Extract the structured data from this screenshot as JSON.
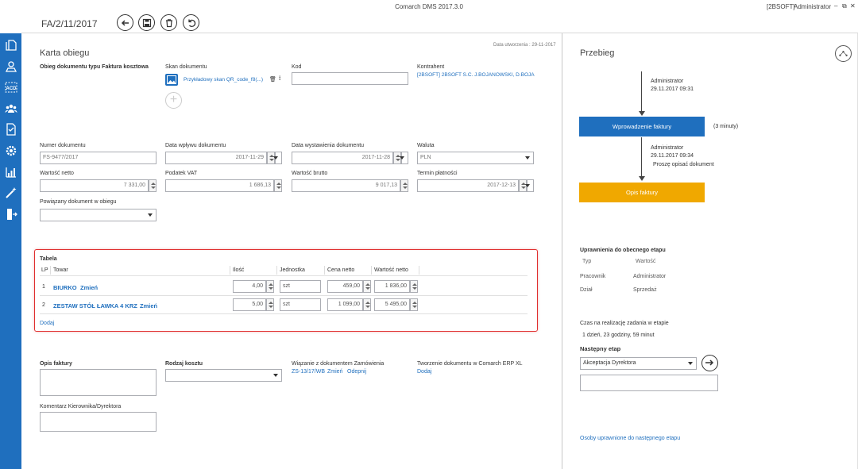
{
  "window": {
    "title": "Comarch DMS 2017.3.0",
    "company": "[2BSOFT]",
    "user": "Administrator"
  },
  "header": {
    "doc_number": "FA/2/11/2017",
    "created_label": "Data utworzenia : 29-11-2017"
  },
  "form": {
    "section_title": "Karta obiegu",
    "doc_type_label": "Obieg dokumentu typu Faktura kosztowa",
    "scan_label": "Skan dokumentu",
    "scan_file": "Przykładowy skan QR_code_f8(...)",
    "code_label": "Kod",
    "code_value": "",
    "contractor_label": "Kontrahent",
    "contractor_value": "[2BSOFT] 2BSOFT S.C.   J.BOJANOWSKI, D.BOJA",
    "doc_no_label": "Numer dokumentu",
    "doc_no_value": "FS-9477/2017",
    "receipt_date_label": "Data wpływu dokumentu",
    "receipt_date_value": "2017-11-29",
    "issue_date_label": "Data wystawienia dokumentu",
    "issue_date_value": "2017-11-28",
    "currency_label": "Waluta",
    "currency_value": "PLN",
    "net_label": "Wartość netto",
    "net_value": "7 331,00",
    "vat_label": "Podatek VAT",
    "vat_value": "1 686,13",
    "gross_label": "Wartość brutto",
    "gross_value": "9 017,13",
    "due_label": "Termin płatności",
    "due_value": "2017-12-13",
    "related_label": "Powiązany dokument w obiegu",
    "related_value": ""
  },
  "table": {
    "title": "Tabela",
    "headers": [
      "LP",
      "Towar",
      "Ilość",
      "Jednostka",
      "Cena netto",
      "Wartość netto"
    ],
    "rows": [
      {
        "lp": "1",
        "item": "BIURKO",
        "change": "Zmień",
        "qty": "4,00",
        "unit": "szt",
        "price": "459,00",
        "value": "1 836,00"
      },
      {
        "lp": "2",
        "item": "ZESTAW STÓŁ ŁAWKA 4 KRZ",
        "change": "Zmień",
        "qty": "5,00",
        "unit": "szt",
        "price": "1 099,00",
        "value": "5 495,00"
      }
    ],
    "add_label": "Dodaj"
  },
  "bottom": {
    "invoice_desc_label": "Opis faktury",
    "cost_type_label": "Rodzaj kosztu",
    "order_link_label": "Wiązanie z dokumentem Zamówienia",
    "order_ref": "ZS-13/17/WB",
    "order_change": "Zmień",
    "order_unlink": "Odepnij",
    "erp_label": "Tworzenie dokumentu w Comarch ERP XL",
    "erp_add": "Dodaj",
    "comment_label": "Komentarz Kierownika/Dyrektora"
  },
  "flow": {
    "title": "Przebieg",
    "step1_user": "Administrator",
    "step1_date": "29.11.2017 09:31",
    "step1_box": "Wprowadzenie faktury",
    "step1_duration": "(3 minuty)",
    "step2_user": "Administrator",
    "step2_date": "29.11.2017 09:34",
    "step2_note": "Proszę opisać dokument",
    "step2_box": "Opis faktury",
    "perm_title": "Uprawnienia do obecnego etapu",
    "perm_type_h": "Typ",
    "perm_value_h": "Wartość",
    "perm_r1_type": "Pracownik",
    "perm_r1_value": "Administrator",
    "perm_r2_type": "Dział",
    "perm_r2_value": "Sprzedaż",
    "time_label": "Czas na realizację zadania w etapie",
    "time_value": "1 dzień, 23 godziny, 59 minut",
    "next_label": "Następny etap",
    "next_value": "Akceptacja Dyrektora",
    "next_users_link": "Osoby uprawnione do następnego etapu"
  },
  "colors": {
    "sidebar": "#1f6fbe",
    "step_blue": "#1f6fbe",
    "step_orange": "#f0a800",
    "table_border": "#e03030",
    "link": "#1f6fbe"
  }
}
